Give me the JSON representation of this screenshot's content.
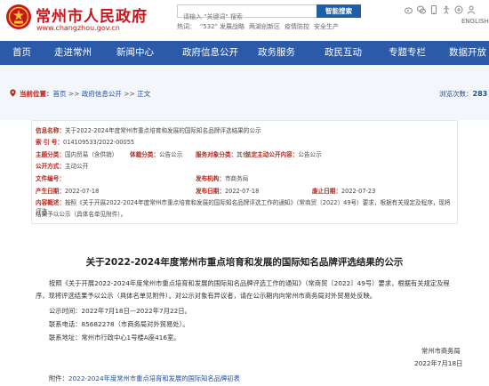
{
  "header": {
    "site_name": "常州市人民政府",
    "site_url": "www.changzhou.gov.cn",
    "search_placeholder": "请输入 \"关键词\" 搜索",
    "search_button": "智能搜索",
    "hot_label": "热词：",
    "hot_words": [
      "\"532\" 发展战略",
      "两湖创新区",
      "疫情防控",
      "安全生产"
    ],
    "lang": "ENGLISH"
  },
  "nav": {
    "items": [
      "首页",
      "走进常州",
      "新闻中心",
      "政府信息公开",
      "政务服务",
      "政民互动",
      "专题专栏",
      "数据开放"
    ]
  },
  "breadcrumb": {
    "prefix": "当前位置：",
    "items": [
      "首页",
      "政府信息公开",
      "正文"
    ],
    "separator": ">>",
    "views_label": "浏览次数：",
    "views_count": "283"
  },
  "meta": {
    "info_name_label": "信息名称：",
    "info_name": "关于2022-2024年度常州市重点培育和发展的国际知名品牌评选结果的公示",
    "index_label": "索 引 号：",
    "index_no": "014109533/2022-00055",
    "theme_label": "主题分类：",
    "theme": "国内贸易（含供销）",
    "carrier_label": "体裁分类：",
    "carrier": "公告公示",
    "service_label": "服务对象分类：",
    "service": "其他",
    "statutory_label": "法定主动公开内容：",
    "statutory": "公告公示",
    "open_label": "公开方式：",
    "open": "主动公开",
    "doc_label": "文件编号：",
    "doc": "",
    "issuer_label": "发布机构：",
    "issuer": "市商务局",
    "created_label": "产生日期：",
    "created": "2022-07-18",
    "published_label": "发布日期：",
    "published": "2022-07-18",
    "deposit_label": "废止日期：",
    "deposit": "2022-07-23",
    "summary_label": "内容概述：",
    "summary_1": "按照《关于开展2022-2024年度常州市重点培育和发展的国际知名品牌评选工作的通知》（常商贸〔2022〕49号）要求，根据有关规定及程序，现将评选",
    "summary_2": "结果予以公示（具体名单见附件）。"
  },
  "article": {
    "title": "关于2022-2024年度常州市重点培育和发展的国际知名品牌评选结果的公示",
    "p1_line1": "按照《关于开展2022-2024年度常州市重点培育和发展的国际知名品牌评选工作的通知》（常商贸〔2022〕49号）要求，根据有关规定及程",
    "p1_line2": "序，现将评选结果予以公示（具体名单见附件）。对公示对象有异议者，请在公示期内向常州市商务局对外贸易处反映。",
    "period": "公示时间：2022年7月18日—2022年7月22日。",
    "phone": "联系电话：85682278（市商务局对外贸易处）。",
    "address": "联系地址：常州市行政中心1号楼A座416室。",
    "signer": "常州市商务局",
    "date": "2022年7月18日",
    "attachment_label": "附件：",
    "attachment": "2022-2024年度常州市重点培育和发展的国际知名品牌初表"
  },
  "colors": {
    "brand_red": "#c8161d",
    "nav_blue": "#2a5aa8",
    "link_blue": "#1f4f96"
  }
}
